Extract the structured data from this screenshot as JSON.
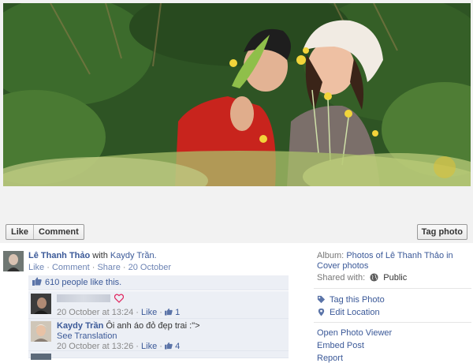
{
  "photo": {
    "like_label": "Like",
    "comment_label": "Comment",
    "tag_photo_label": "Tag photo"
  },
  "post": {
    "owner_name": "Lê Thanh Thảo",
    "with_text": "with",
    "tagged_name": "Kaydy Trần.",
    "like_link": "Like",
    "comment_link": "Comment",
    "share_link": "Share",
    "date": "20 October",
    "dot": "·"
  },
  "likes": {
    "text": "610 people like this."
  },
  "comments": [
    {
      "name": "",
      "text": "",
      "time": "20 October at 13:24",
      "like_link": "Like",
      "like_count": "1"
    },
    {
      "name": "Kaydy Trần",
      "text": "Ôi anh áo đỏ đẹp trai :\">",
      "see_translation": "See Translation",
      "time": "20 October at 13:26",
      "like_link": "Like",
      "like_count": "4"
    }
  ],
  "sidebar": {
    "album_label": "Album:",
    "album_name": "Photos of Lê Thanh Thảo in Cover photos",
    "shared_label": "Shared with:",
    "shared_value": "Public",
    "tag_this_photo": "Tag this Photo",
    "edit_location": "Edit Location",
    "open_photo_viewer": "Open Photo Viewer",
    "embed_post": "Embed Post",
    "report": "Report"
  },
  "colors": {
    "link": "#3b5998",
    "ufi_bg": "#eceff5",
    "heart": "#e0245e"
  }
}
